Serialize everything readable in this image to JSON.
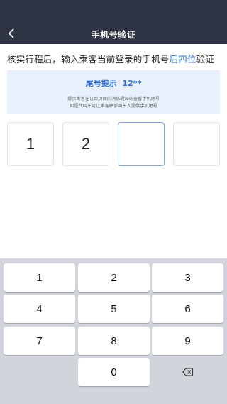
{
  "navbar": {
    "title": "手机号验证",
    "back_icon": "chevron-left-icon"
  },
  "instruction": {
    "prefix": "核实行程后，输入乘客当前登录的手机号",
    "highlight": "后四位",
    "suffix": "验证"
  },
  "hint": {
    "label": "尾号提示",
    "value": "12**",
    "line1": "提示乘客在订单页面的消息通知条查看手机尾号",
    "line2": "如是代叫车可让乘客联系叫车人提供手机尾号"
  },
  "code_boxes": [
    {
      "value": "1"
    },
    {
      "value": "2"
    },
    {
      "value": ""
    },
    {
      "value": ""
    }
  ],
  "keyboard": {
    "keys": [
      "1",
      "2",
      "3",
      "4",
      "5",
      "6",
      "7",
      "8",
      "9",
      "0"
    ],
    "delete_icon": "backspace-icon"
  },
  "colors": {
    "navbar": "#2f3444",
    "accent": "#2f6fd8",
    "hint_bg": "#e7f0fb",
    "keyboard_bg": "#d1d4da"
  }
}
